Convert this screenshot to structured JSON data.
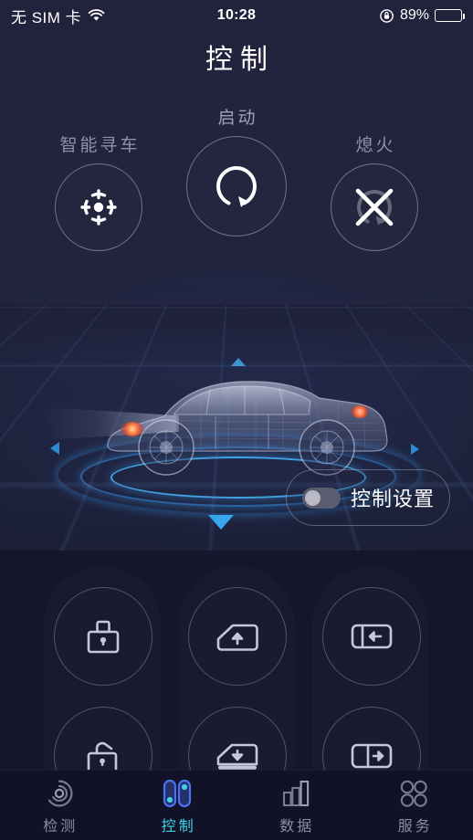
{
  "status_bar": {
    "carrier": "无 SIM 卡",
    "wifi_icon": "wifi-icon",
    "time": "10:28",
    "rotation_lock_icon": "rotation-lock-icon",
    "battery_percent": "89%",
    "battery_level": 89
  },
  "header": {
    "title": "控制"
  },
  "top_controls": [
    {
      "label": "智能寻车",
      "icon": "crosshair-target-icon",
      "name": "find-car-button"
    },
    {
      "label": "启动",
      "icon": "engine-start-icon",
      "name": "engine-start-button"
    },
    {
      "label": "熄火",
      "icon": "engine-stop-icon",
      "name": "engine-stop-button"
    }
  ],
  "hero": {
    "car_icon": "car-hologram-icon",
    "markers": [
      "triangle-up",
      "triangle-left",
      "triangle-right",
      "triangle-down"
    ]
  },
  "settings": {
    "label": "控制设置",
    "toggle_on": false,
    "toggle_icon": "toggle-switch-off"
  },
  "grid_buttons": [
    {
      "name": "lock-doors-button",
      "icon": "lock-icon"
    },
    {
      "name": "window-up-button",
      "icon": "window-up-icon"
    },
    {
      "name": "trunk-close-button",
      "icon": "door-arrow-left-icon"
    },
    {
      "name": "unlock-doors-button",
      "icon": "unlock-icon"
    },
    {
      "name": "window-down-button",
      "icon": "window-down-icon"
    },
    {
      "name": "trunk-open-button",
      "icon": "door-arrow-right-icon"
    }
  ],
  "tabs": [
    {
      "label": "检测",
      "icon": "radar-detect-icon",
      "active": false
    },
    {
      "label": "控制",
      "icon": "control-toggles-icon",
      "active": true
    },
    {
      "label": "数据",
      "icon": "bar-chart-icon",
      "active": false
    },
    {
      "label": "服务",
      "icon": "grid-dots-icon",
      "active": false
    }
  ],
  "colors": {
    "accent_cyan": "#3fd2e8",
    "accent_blue": "#4a72f5",
    "ring_blue": "#3fa9e8",
    "background": "#14142a",
    "panel": "#15162b",
    "status_bar": "#22223c",
    "muted_text": "#8f90a8"
  }
}
